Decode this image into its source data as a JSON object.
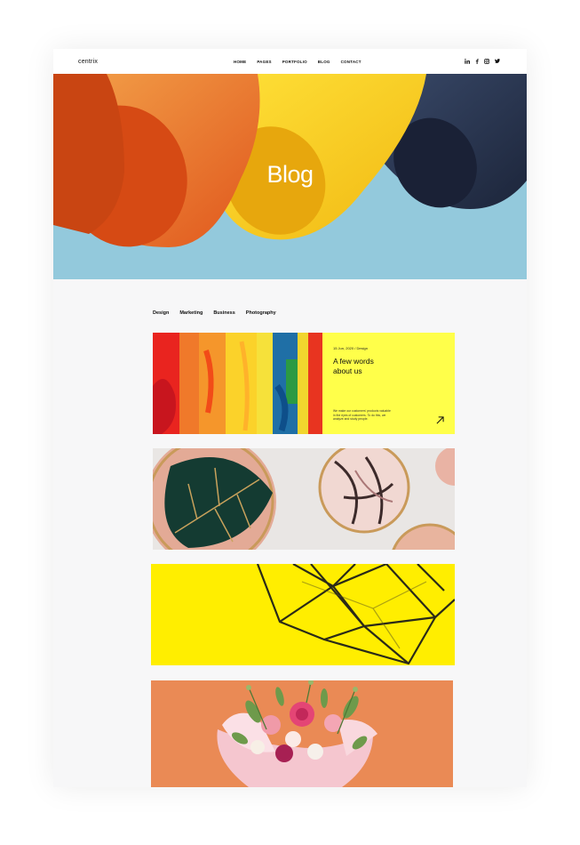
{
  "header": {
    "logo": "centrix",
    "nav": [
      "HOME",
      "PAGES",
      "PORTFOLIO",
      "BLOG",
      "CONTACT"
    ],
    "social_icons": [
      "linkedin-icon",
      "facebook-icon",
      "instagram-icon",
      "twitter-icon"
    ]
  },
  "hero": {
    "title": "Blog"
  },
  "categories": [
    "Design",
    "Marketing",
    "Business",
    "Photography"
  ],
  "posts": [
    {
      "meta": "15 Jun, 2020 / Design",
      "title_line1": "A few words",
      "title_line2": "about us",
      "excerpt": "We make our customers' products valuable in the eyes of customers. To do this, we analyze and study people."
    }
  ],
  "colors": {
    "accent_yellow": "#ffff4a",
    "hero_blue": "#9fcfe0",
    "page_bg": "#f7f7f8"
  }
}
